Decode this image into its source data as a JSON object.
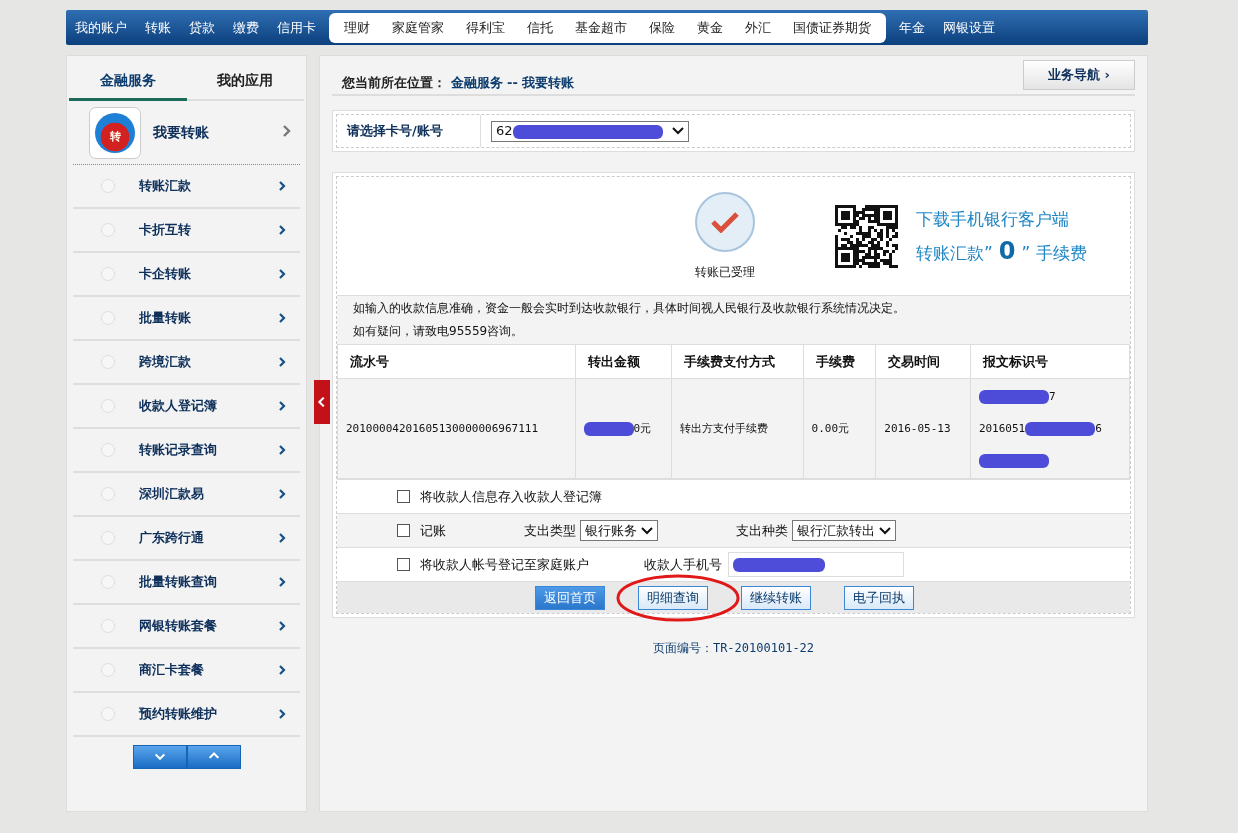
{
  "top_nav": {
    "left": [
      {
        "label": "我的账户"
      },
      {
        "label": "转账"
      },
      {
        "label": "贷款"
      },
      {
        "label": "缴费"
      },
      {
        "label": "信用卡"
      }
    ],
    "middle": [
      {
        "label": "理财"
      },
      {
        "label": "家庭管家"
      },
      {
        "label": "得利宝"
      },
      {
        "label": "信托"
      },
      {
        "label": "基金超市"
      },
      {
        "label": "保险"
      },
      {
        "label": "黄金"
      },
      {
        "label": "外汇"
      },
      {
        "label": "国债证券期货"
      }
    ],
    "right": [
      {
        "label": "年金"
      },
      {
        "label": "网银设置"
      }
    ]
  },
  "sidebar": {
    "tabs": [
      {
        "label": "金融服务",
        "selected": true
      },
      {
        "label": "我的应用",
        "selected": false
      }
    ],
    "header": {
      "label": "我要转账",
      "badge": "转"
    },
    "items": [
      {
        "label": "转账汇款"
      },
      {
        "label": "卡折互转"
      },
      {
        "label": "卡企转账"
      },
      {
        "label": "批量转账"
      },
      {
        "label": "跨境汇款"
      },
      {
        "label": "收款人登记簿"
      },
      {
        "label": "转账记录查询"
      },
      {
        "label": "深圳汇款易"
      },
      {
        "label": "广东跨行通"
      },
      {
        "label": "批量转账查询"
      },
      {
        "label": "网银转账套餐"
      },
      {
        "label": "商汇卡套餐"
      },
      {
        "label": "预约转账维护"
      }
    ]
  },
  "breadcrumb": {
    "prefix": "您当前所在位置：",
    "path": "金融服务 -- 我要转账"
  },
  "nav_button": "业务导航 ›",
  "account": {
    "label": "请选择卡号/账号",
    "value": "62"
  },
  "result": {
    "status": "转账已受理",
    "promo_line1": "下载手机银行客户端",
    "promo_before": "转账汇款”",
    "promo_zero": "0",
    "promo_after": "” 手续费"
  },
  "notes": [
    "如输入的收款信息准确，资金一般会实时到达收款银行，具体时间视人民银行及收款银行系统情况决定。",
    "如有疑问，请致电95559咨询。"
  ],
  "table": {
    "columns": [
      "流水号",
      "转出金额",
      "手续费支付方式",
      "手续费",
      "交易时间",
      "报文标识号"
    ],
    "row": [
      [
        [
          {
            "kind": "text",
            "text": "20100004201605130000006967111"
          }
        ]
      ],
      [
        [
          {
            "kind": "redacted"
          },
          {
            "kind": "text",
            "text": "0元"
          }
        ]
      ],
      [
        [
          {
            "kind": "text",
            "text": "转出方支付手续费"
          }
        ]
      ],
      [
        [
          {
            "kind": "text",
            "text": "0.00元"
          }
        ]
      ],
      [
        [
          {
            "kind": "text",
            "text": "2016-05-13"
          }
        ]
      ],
      [
        [
          {
            "kind": "redacted"
          },
          {
            "kind": "text",
            "text": "7"
          }
        ],
        [
          {
            "kind": "text",
            "text": "2016051"
          },
          {
            "kind": "redacted"
          },
          {
            "kind": "text",
            "text": "6"
          }
        ],
        [
          {
            "kind": "redacted"
          }
        ]
      ]
    ]
  },
  "options": [
    {
      "kind": "checkbox",
      "label": "将收款人信息存入收款人登记簿",
      "checked": false
    },
    {
      "kind": "selects",
      "label": "记账",
      "checked": false,
      "type_label": "支出类型",
      "type_value": "银行账务",
      "sort_label": "支出种类",
      "sort_value": "银行汇款转出"
    },
    {
      "kind": "phone",
      "label": "将收款人帐号登记至家庭账户",
      "checked": false,
      "phone_label": "收款人手机号"
    }
  ],
  "buttons": [
    {
      "label": "返回首页",
      "selected": true
    },
    {
      "label": "明细查询",
      "selected": false
    },
    {
      "label": "继续转账",
      "selected": false
    },
    {
      "label": "电子回执",
      "selected": false
    }
  ],
  "page_code": "页面编号：TR-20100101-22"
}
